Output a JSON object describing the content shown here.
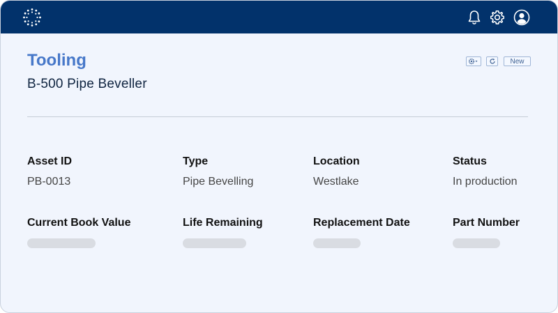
{
  "header": {
    "icons": [
      "bell-icon",
      "gear-icon",
      "account-icon"
    ],
    "bar_color": "#02326b"
  },
  "page": {
    "title": "Tooling",
    "subtitle": "B-500 Pipe Beveller",
    "title_color": "#4778c9"
  },
  "toolbar": {
    "settings_icon": "gear-dropdown-icon",
    "refresh_icon": "refresh-icon",
    "new_label": "New"
  },
  "details": {
    "asset_id": {
      "label": "Asset ID",
      "value": "PB-0013"
    },
    "type": {
      "label": "Type",
      "value": "Pipe Bevelling"
    },
    "location": {
      "label": "Location",
      "value": "Westlake"
    },
    "status": {
      "label": "Status",
      "value": "In production"
    },
    "current_book_value": {
      "label": "Current Book Value",
      "value": null
    },
    "life_remaining": {
      "label": "Life Remaining",
      "value": null
    },
    "replacement_date": {
      "label": "Replacement Date",
      "value": null
    },
    "part_number": {
      "label": "Part Number",
      "value": null
    }
  }
}
